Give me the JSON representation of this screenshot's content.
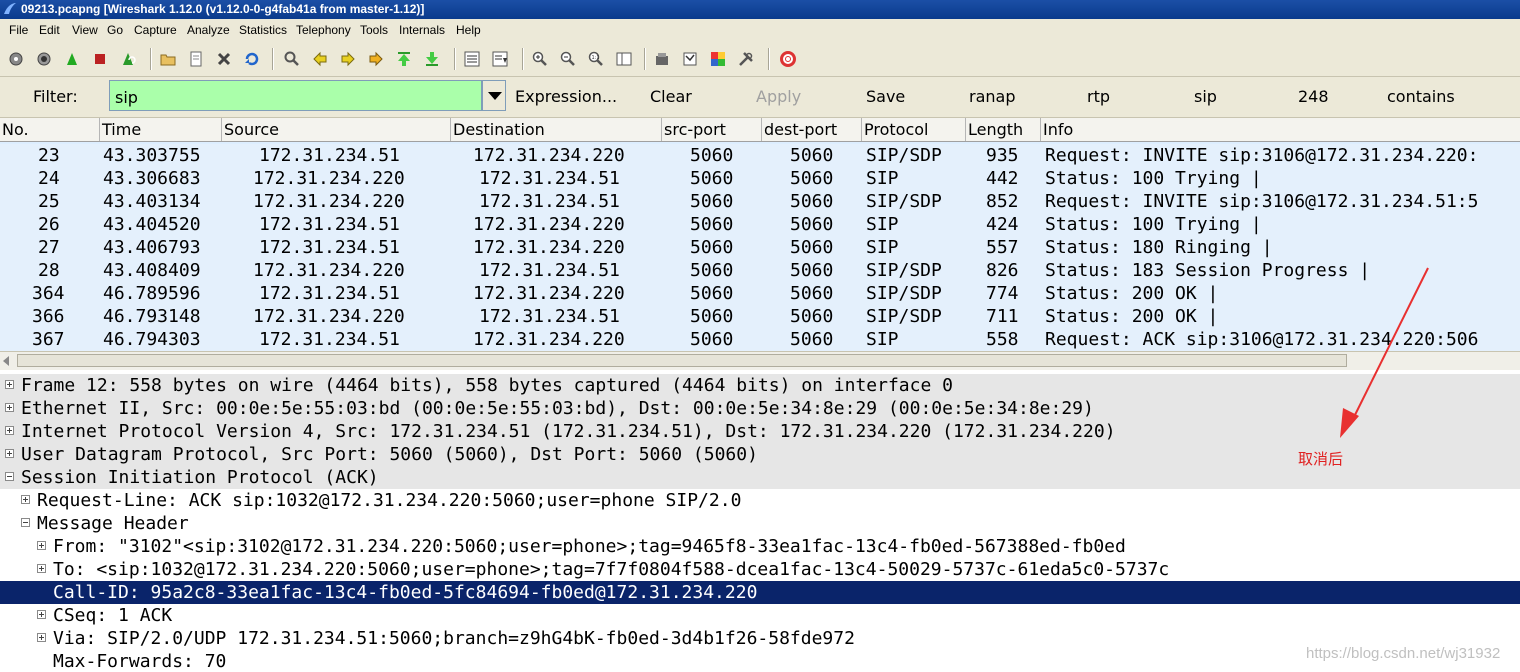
{
  "window": {
    "title": "09213.pcapng  [Wireshark 1.12.0  (v1.12.0-0-g4fab41a from master-1.12)]"
  },
  "menu": [
    "File",
    "Edit",
    "View",
    "Go",
    "Capture",
    "Analyze",
    "Statistics",
    "Telephony",
    "Tools",
    "Internals",
    "Help"
  ],
  "filter": {
    "label": "Filter:",
    "value": "sip",
    "buttons": [
      "Expression...",
      "Clear",
      "Apply",
      "Save",
      "ranap",
      "rtp",
      "sip",
      "248",
      "contains"
    ]
  },
  "columns": [
    "No.",
    "Time",
    "Source",
    "Destination",
    "src-port",
    "dest-port",
    "Protocol",
    "Length",
    "Info"
  ],
  "packets": [
    [
      "23",
      "43.303755",
      "172.31.234.51",
      "172.31.234.220",
      "5060",
      "5060",
      "SIP/SDP",
      "935",
      "Request: INVITE sip:3106@172.31.234.220:"
    ],
    [
      "24",
      "43.306683",
      "172.31.234.220",
      "172.31.234.51",
      "5060",
      "5060",
      "SIP",
      "442",
      "Status: 100 Trying |"
    ],
    [
      "25",
      "43.403134",
      "172.31.234.220",
      "172.31.234.51",
      "5060",
      "5060",
      "SIP/SDP",
      "852",
      "Request: INVITE sip:3106@172.31.234.51:5"
    ],
    [
      "26",
      "43.404520",
      "172.31.234.51",
      "172.31.234.220",
      "5060",
      "5060",
      "SIP",
      "424",
      "Status: 100 Trying |"
    ],
    [
      "27",
      "43.406793",
      "172.31.234.51",
      "172.31.234.220",
      "5060",
      "5060",
      "SIP",
      "557",
      "Status: 180 Ringing |"
    ],
    [
      "28",
      "43.408409",
      "172.31.234.220",
      "172.31.234.51",
      "5060",
      "5060",
      "SIP/SDP",
      "826",
      "Status: 183 Session Progress |"
    ],
    [
      "364",
      "46.789596",
      "172.31.234.51",
      "172.31.234.220",
      "5060",
      "5060",
      "SIP/SDP",
      "774",
      "Status: 200 OK |"
    ],
    [
      "366",
      "46.793148",
      "172.31.234.220",
      "172.31.234.51",
      "5060",
      "5060",
      "SIP/SDP",
      "711",
      "Status: 200 OK |"
    ],
    [
      "367",
      "46.794303",
      "172.31.234.51",
      "172.31.234.220",
      "5060",
      "5060",
      "SIP",
      "558",
      "Request: ACK sip:3106@172.31.234.220:506"
    ]
  ],
  "details": [
    "Frame 12: 558 bytes on wire (4464 bits), 558 bytes captured (4464 bits) on interface 0",
    "Ethernet II, Src: 00:0e:5e:55:03:bd (00:0e:5e:55:03:bd), Dst: 00:0e:5e:34:8e:29 (00:0e:5e:34:8e:29)",
    "Internet Protocol Version 4, Src: 172.31.234.51 (172.31.234.51), Dst: 172.31.234.220 (172.31.234.220)",
    "User Datagram Protocol, Src Port: 5060 (5060), Dst Port: 5060 (5060)",
    "Session Initiation Protocol (ACK)",
    "Request-Line: ACK sip:1032@172.31.234.220:5060;user=phone SIP/2.0",
    "Message Header",
    "From: \"3102\"<sip:3102@172.31.234.220:5060;user=phone>;tag=9465f8-33ea1fac-13c4-fb0ed-567388ed-fb0ed",
    "To: <sip:1032@172.31.234.220:5060;user=phone>;tag=7f7f0804f588-dcea1fac-13c4-50029-5737c-61eda5c0-5737c",
    "Call-ID: 95a2c8-33ea1fac-13c4-fb0ed-5fc84694-fb0ed@172.31.234.220",
    "CSeq: 1 ACK",
    "Via: SIP/2.0/UDP 172.31.234.51:5060;branch=z9hG4bK-fb0ed-3d4b1f26-58fde972",
    "Max-Forwards: 70"
  ],
  "annotation": "取消后",
  "watermark": "https://blog.csdn.net/wj31932"
}
